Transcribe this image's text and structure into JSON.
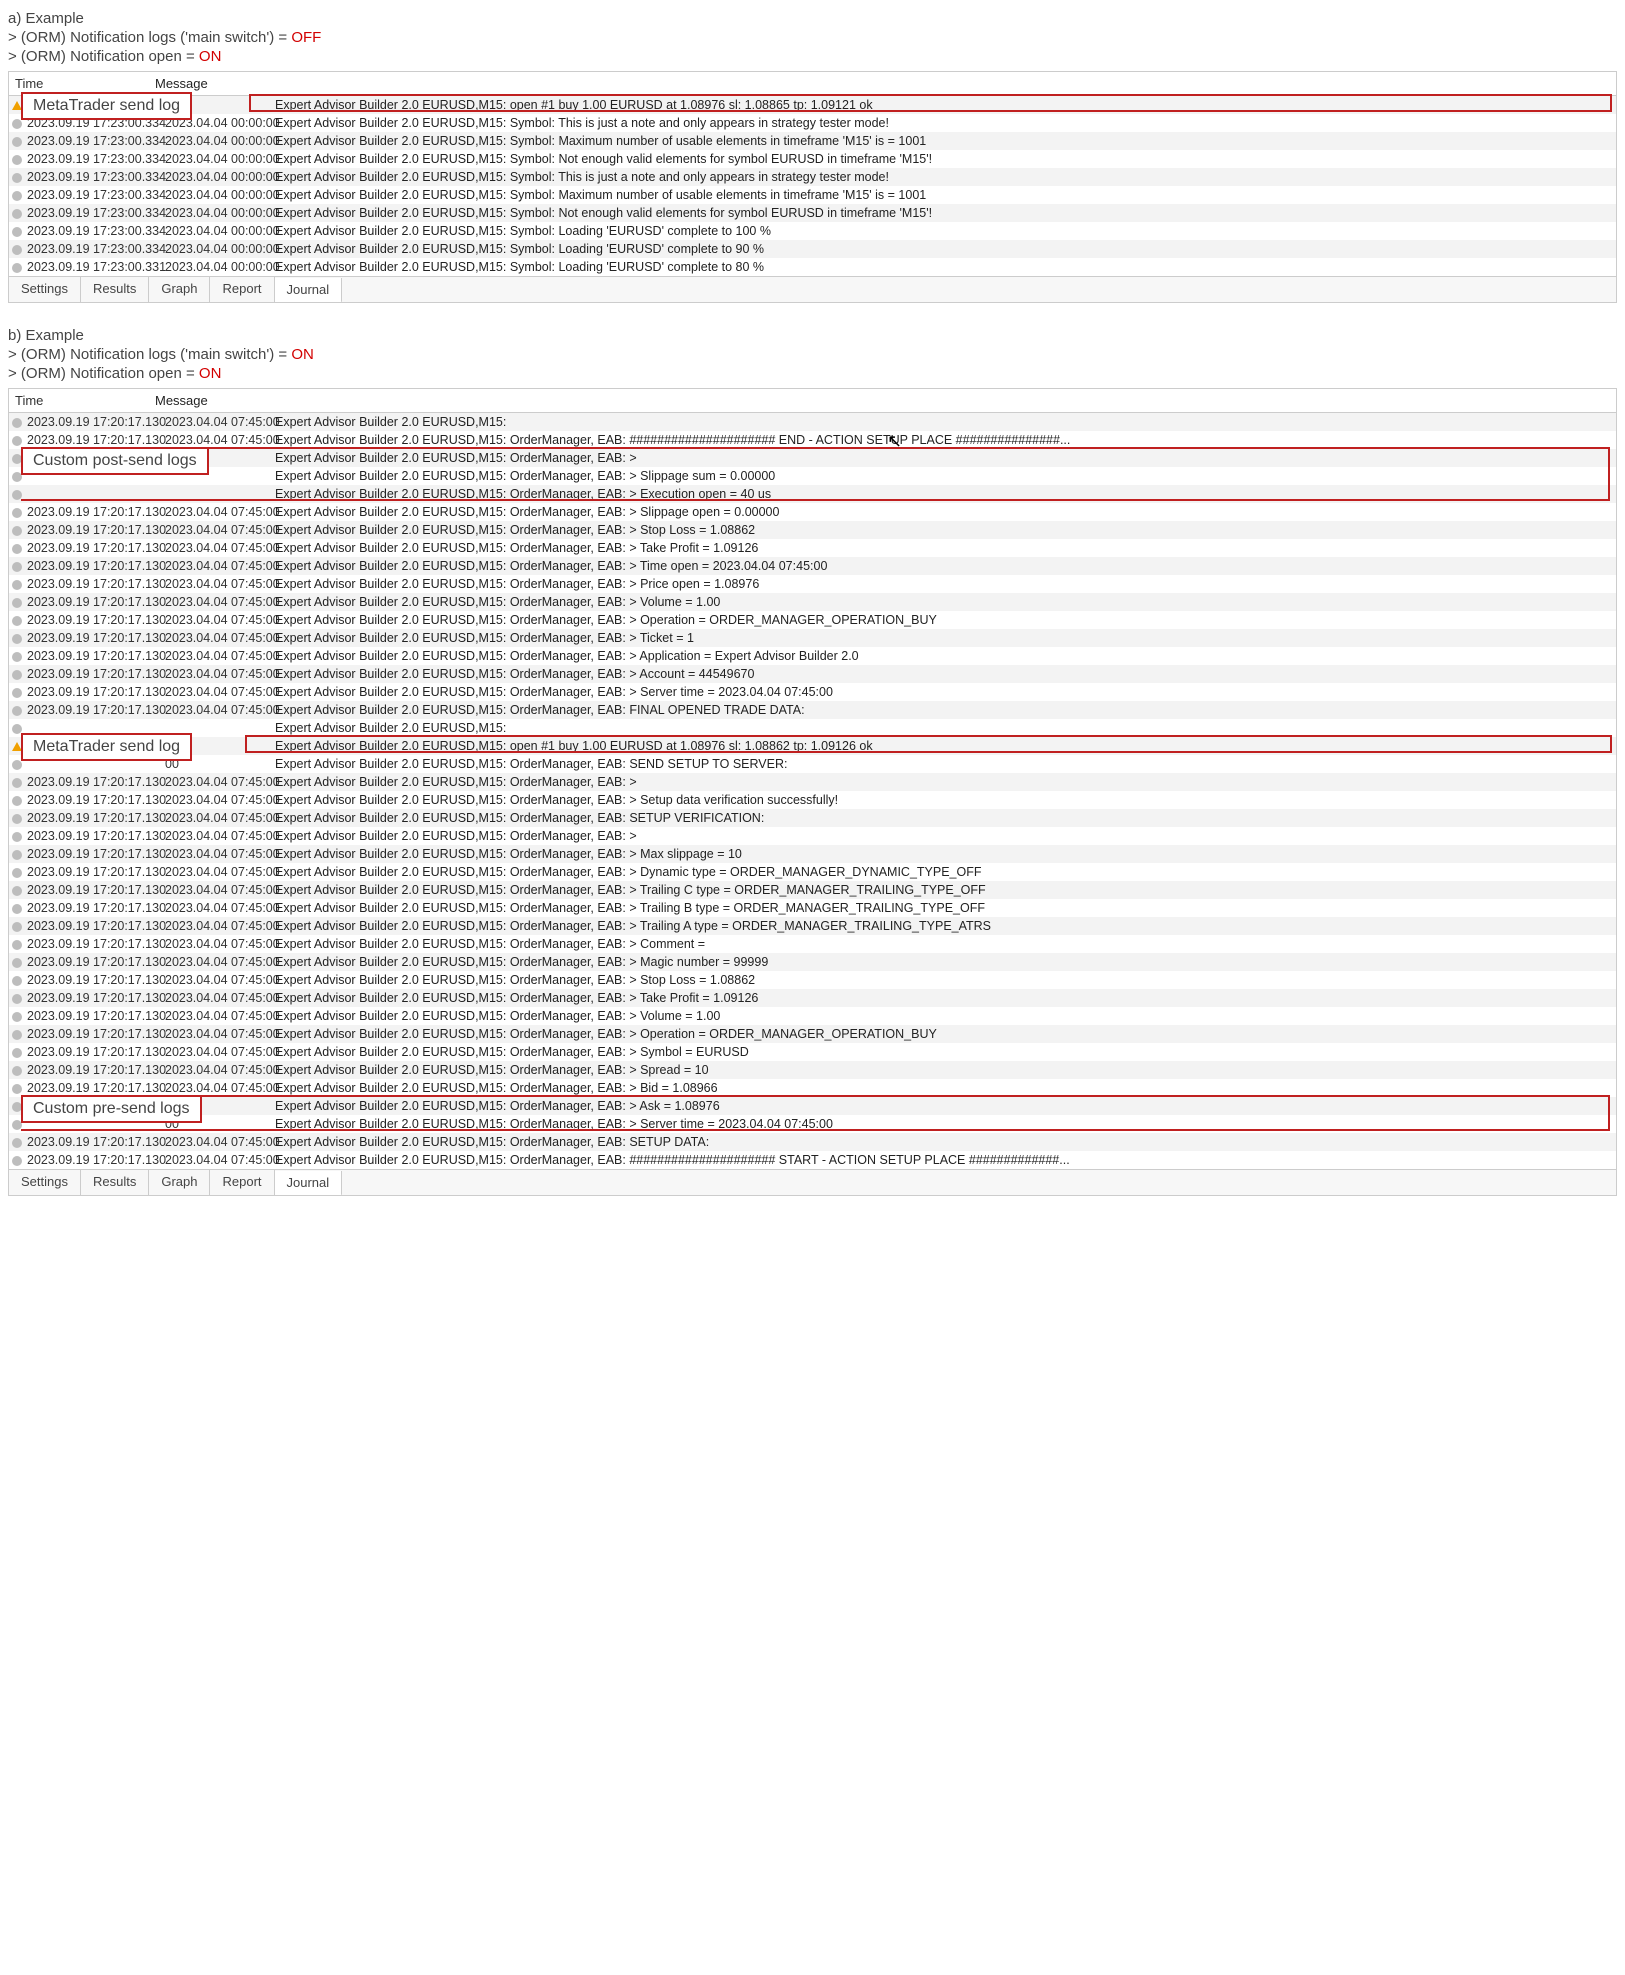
{
  "sections": {
    "a": {
      "title": "a) Example",
      "settings": [
        {
          "label": "> (ORM) Notification logs ('main switch') = ",
          "value": "OFF",
          "cls": "off"
        },
        {
          "label": "> (ORM) Notification open = ",
          "value": "ON",
          "cls": "on"
        }
      ],
      "callouts": {
        "mt_send": "MetaTrader send log"
      },
      "headers": {
        "time": "Time",
        "message": "Message"
      },
      "rows": [
        {
          "icon": "warn",
          "time": "",
          "ts2": "00",
          "msg": "Expert Advisor Builder 2.0 EURUSD,M15: open #1 buy 1.00 EURUSD at 1.08976 sl: 1.08865 tp: 1.09121 ok"
        },
        {
          "icon": "dot",
          "time": "2023.09.19 17:23:00.334",
          "ts2": "2023.04.04 00:00:00",
          "msg": "Expert Advisor Builder 2.0 EURUSD,M15: Symbol: This is just a note and only appears in strategy tester mode!"
        },
        {
          "icon": "dot",
          "time": "2023.09.19 17:23:00.334",
          "ts2": "2023.04.04 00:00:00",
          "msg": "Expert Advisor Builder 2.0 EURUSD,M15: Symbol: Maximum number of usable elements in timeframe 'M15' is = 1001"
        },
        {
          "icon": "dot",
          "time": "2023.09.19 17:23:00.334",
          "ts2": "2023.04.04 00:00:00",
          "msg": "Expert Advisor Builder 2.0 EURUSD,M15: Symbol: Not enough valid elements for symbol EURUSD in timeframe 'M15'!"
        },
        {
          "icon": "dot",
          "time": "2023.09.19 17:23:00.334",
          "ts2": "2023.04.04 00:00:00",
          "msg": "Expert Advisor Builder 2.0 EURUSD,M15: Symbol: This is just a note and only appears in strategy tester mode!"
        },
        {
          "icon": "dot",
          "time": "2023.09.19 17:23:00.334",
          "ts2": "2023.04.04 00:00:00",
          "msg": "Expert Advisor Builder 2.0 EURUSD,M15: Symbol: Maximum number of usable elements in timeframe 'M15' is = 1001"
        },
        {
          "icon": "dot",
          "time": "2023.09.19 17:23:00.334",
          "ts2": "2023.04.04 00:00:00",
          "msg": "Expert Advisor Builder 2.0 EURUSD,M15: Symbol: Not enough valid elements for symbol EURUSD in timeframe 'M15'!"
        },
        {
          "icon": "dot",
          "time": "2023.09.19 17:23:00.334",
          "ts2": "2023.04.04 00:00:00",
          "msg": "Expert Advisor Builder 2.0 EURUSD,M15: Symbol: Loading 'EURUSD' complete to 100 %"
        },
        {
          "icon": "dot",
          "time": "2023.09.19 17:23:00.334",
          "ts2": "2023.04.04 00:00:00",
          "msg": "Expert Advisor Builder 2.0 EURUSD,M15: Symbol: Loading 'EURUSD' complete to 90 %"
        },
        {
          "icon": "dot",
          "time": "2023.09.19 17:23:00.331",
          "ts2": "2023.04.04 00:00:00",
          "msg": "Expert Advisor Builder 2.0 EURUSD,M15: Symbol: Loading 'EURUSD' complete to 80 %"
        }
      ]
    },
    "b": {
      "title": "b) Example",
      "settings": [
        {
          "label": "> (ORM) Notification logs ('main switch') = ",
          "value": "ON",
          "cls": "on"
        },
        {
          "label": "> (ORM) Notification open = ",
          "value": "ON",
          "cls": "on"
        }
      ],
      "callouts": {
        "post": "Custom post-send logs",
        "mt_send": "MetaTrader send log",
        "pre": "Custom pre-send logs"
      },
      "headers": {
        "time": "Time",
        "message": "Message"
      },
      "rows": [
        {
          "icon": "dot",
          "time": "2023.09.19 17:20:17.130",
          "ts2": "2023.04.04 07:45:00",
          "msg": "Expert Advisor Builder 2.0 EURUSD,M15:"
        },
        {
          "icon": "dot",
          "time": "2023.09.19 17:20:17.130",
          "ts2": "2023.04.04 07:45:00",
          "msg": "Expert Advisor Builder 2.0 EURUSD,M15: OrderManager, EAB: ##################### END - ACTION SETUP PLACE ###############..."
        },
        {
          "icon": "dot",
          "time": "",
          "ts2": "",
          "msg": "Expert Advisor Builder 2.0 EURUSD,M15: OrderManager, EAB: >"
        },
        {
          "icon": "dot",
          "time": "",
          "ts2": "",
          "msg": "Expert Advisor Builder 2.0 EURUSD,M15: OrderManager, EAB: > Slippage sum = 0.00000"
        },
        {
          "icon": "dot",
          "time": "",
          "ts2": "",
          "msg": "Expert Advisor Builder 2.0 EURUSD,M15: OrderManager, EAB: > Execution open = 40 us"
        },
        {
          "icon": "dot",
          "time": "2023.09.19 17:20:17.130",
          "ts2": "2023.04.04 07:45:00",
          "msg": "Expert Advisor Builder 2.0 EURUSD,M15: OrderManager, EAB: > Slippage open = 0.00000"
        },
        {
          "icon": "dot",
          "time": "2023.09.19 17:20:17.130",
          "ts2": "2023.04.04 07:45:00",
          "msg": "Expert Advisor Builder 2.0 EURUSD,M15: OrderManager, EAB: > Stop Loss = 1.08862"
        },
        {
          "icon": "dot",
          "time": "2023.09.19 17:20:17.130",
          "ts2": "2023.04.04 07:45:00",
          "msg": "Expert Advisor Builder 2.0 EURUSD,M15: OrderManager, EAB: > Take Profit = 1.09126"
        },
        {
          "icon": "dot",
          "time": "2023.09.19 17:20:17.130",
          "ts2": "2023.04.04 07:45:00",
          "msg": "Expert Advisor Builder 2.0 EURUSD,M15: OrderManager, EAB: > Time open = 2023.04.04 07:45:00"
        },
        {
          "icon": "dot",
          "time": "2023.09.19 17:20:17.130",
          "ts2": "2023.04.04 07:45:00",
          "msg": "Expert Advisor Builder 2.0 EURUSD,M15: OrderManager, EAB: > Price open = 1.08976"
        },
        {
          "icon": "dot",
          "time": "2023.09.19 17:20:17.130",
          "ts2": "2023.04.04 07:45:00",
          "msg": "Expert Advisor Builder 2.0 EURUSD,M15: OrderManager, EAB: > Volume = 1.00"
        },
        {
          "icon": "dot",
          "time": "2023.09.19 17:20:17.130",
          "ts2": "2023.04.04 07:45:00",
          "msg": "Expert Advisor Builder 2.0 EURUSD,M15: OrderManager, EAB: > Operation = ORDER_MANAGER_OPERATION_BUY"
        },
        {
          "icon": "dot",
          "time": "2023.09.19 17:20:17.130",
          "ts2": "2023.04.04 07:45:00",
          "msg": "Expert Advisor Builder 2.0 EURUSD,M15: OrderManager, EAB: > Ticket = 1"
        },
        {
          "icon": "dot",
          "time": "2023.09.19 17:20:17.130",
          "ts2": "2023.04.04 07:45:00",
          "msg": "Expert Advisor Builder 2.0 EURUSD,M15: OrderManager, EAB: > Application = Expert Advisor Builder 2.0"
        },
        {
          "icon": "dot",
          "time": "2023.09.19 17:20:17.130",
          "ts2": "2023.04.04 07:45:00",
          "msg": "Expert Advisor Builder 2.0 EURUSD,M15: OrderManager, EAB: > Account = 44549670"
        },
        {
          "icon": "dot",
          "time": "2023.09.19 17:20:17.130",
          "ts2": "2023.04.04 07:45:00",
          "msg": "Expert Advisor Builder 2.0 EURUSD,M15: OrderManager, EAB: > Server time = 2023.04.04 07:45:00"
        },
        {
          "icon": "dot",
          "time": "2023.09.19 17:20:17.130",
          "ts2": "2023.04.04 07:45:00",
          "msg": "Expert Advisor Builder 2.0 EURUSD,M15: OrderManager, EAB: FINAL OPENED TRADE DATA:"
        },
        {
          "icon": "dot",
          "time": "",
          "ts2": "",
          "msg": "Expert Advisor Builder 2.0 EURUSD,M15:"
        },
        {
          "icon": "warn",
          "time": "",
          "ts2": "00",
          "msg": "Expert Advisor Builder 2.0 EURUSD,M15: open #1 buy 1.00 EURUSD at 1.08976 sl: 1.08862 tp: 1.09126 ok"
        },
        {
          "icon": "dot",
          "time": "",
          "ts2": "00",
          "msg": "Expert Advisor Builder 2.0 EURUSD,M15: OrderManager, EAB: SEND SETUP TO SERVER:"
        },
        {
          "icon": "dot",
          "time": "2023.09.19 17:20:17.130",
          "ts2": "2023.04.04 07:45:00",
          "msg": "Expert Advisor Builder 2.0 EURUSD,M15: OrderManager, EAB: >"
        },
        {
          "icon": "dot",
          "time": "2023.09.19 17:20:17.130",
          "ts2": "2023.04.04 07:45:00",
          "msg": "Expert Advisor Builder 2.0 EURUSD,M15: OrderManager, EAB: > Setup data verification successfully!"
        },
        {
          "icon": "dot",
          "time": "2023.09.19 17:20:17.130",
          "ts2": "2023.04.04 07:45:00",
          "msg": "Expert Advisor Builder 2.0 EURUSD,M15: OrderManager, EAB: SETUP VERIFICATION:"
        },
        {
          "icon": "dot",
          "time": "2023.09.19 17:20:17.130",
          "ts2": "2023.04.04 07:45:00",
          "msg": "Expert Advisor Builder 2.0 EURUSD,M15: OrderManager, EAB: >"
        },
        {
          "icon": "dot",
          "time": "2023.09.19 17:20:17.130",
          "ts2": "2023.04.04 07:45:00",
          "msg": "Expert Advisor Builder 2.0 EURUSD,M15: OrderManager, EAB: > Max slippage = 10"
        },
        {
          "icon": "dot",
          "time": "2023.09.19 17:20:17.130",
          "ts2": "2023.04.04 07:45:00",
          "msg": "Expert Advisor Builder 2.0 EURUSD,M15: OrderManager, EAB: > Dynamic type = ORDER_MANAGER_DYNAMIC_TYPE_OFF"
        },
        {
          "icon": "dot",
          "time": "2023.09.19 17:20:17.130",
          "ts2": "2023.04.04 07:45:00",
          "msg": "Expert Advisor Builder 2.0 EURUSD,M15: OrderManager, EAB: > Trailing C type = ORDER_MANAGER_TRAILING_TYPE_OFF"
        },
        {
          "icon": "dot",
          "time": "2023.09.19 17:20:17.130",
          "ts2": "2023.04.04 07:45:00",
          "msg": "Expert Advisor Builder 2.0 EURUSD,M15: OrderManager, EAB: > Trailing B type = ORDER_MANAGER_TRAILING_TYPE_OFF"
        },
        {
          "icon": "dot",
          "time": "2023.09.19 17:20:17.130",
          "ts2": "2023.04.04 07:45:00",
          "msg": "Expert Advisor Builder 2.0 EURUSD,M15: OrderManager, EAB: > Trailing A type = ORDER_MANAGER_TRAILING_TYPE_ATRS"
        },
        {
          "icon": "dot",
          "time": "2023.09.19 17:20:17.130",
          "ts2": "2023.04.04 07:45:00",
          "msg": "Expert Advisor Builder 2.0 EURUSD,M15: OrderManager, EAB: > Comment ="
        },
        {
          "icon": "dot",
          "time": "2023.09.19 17:20:17.130",
          "ts2": "2023.04.04 07:45:00",
          "msg": "Expert Advisor Builder 2.0 EURUSD,M15: OrderManager, EAB: > Magic number = 99999"
        },
        {
          "icon": "dot",
          "time": "2023.09.19 17:20:17.130",
          "ts2": "2023.04.04 07:45:00",
          "msg": "Expert Advisor Builder 2.0 EURUSD,M15: OrderManager, EAB: > Stop Loss = 1.08862"
        },
        {
          "icon": "dot",
          "time": "2023.09.19 17:20:17.130",
          "ts2": "2023.04.04 07:45:00",
          "msg": "Expert Advisor Builder 2.0 EURUSD,M15: OrderManager, EAB: > Take Profit = 1.09126"
        },
        {
          "icon": "dot",
          "time": "2023.09.19 17:20:17.130",
          "ts2": "2023.04.04 07:45:00",
          "msg": "Expert Advisor Builder 2.0 EURUSD,M15: OrderManager, EAB: > Volume = 1.00"
        },
        {
          "icon": "dot",
          "time": "2023.09.19 17:20:17.130",
          "ts2": "2023.04.04 07:45:00",
          "msg": "Expert Advisor Builder 2.0 EURUSD,M15: OrderManager, EAB: > Operation = ORDER_MANAGER_OPERATION_BUY"
        },
        {
          "icon": "dot",
          "time": "2023.09.19 17:20:17.130",
          "ts2": "2023.04.04 07:45:00",
          "msg": "Expert Advisor Builder 2.0 EURUSD,M15: OrderManager, EAB: > Symbol = EURUSD"
        },
        {
          "icon": "dot",
          "time": "2023.09.19 17:20:17.130",
          "ts2": "2023.04.04 07:45:00",
          "msg": "Expert Advisor Builder 2.0 EURUSD,M15: OrderManager, EAB: > Spread = 10"
        },
        {
          "icon": "dot",
          "time": "2023.09.19 17:20:17.130",
          "ts2": "2023.04.04 07:45:00",
          "msg": "Expert Advisor Builder 2.0 EURUSD,M15: OrderManager, EAB: > Bid = 1.08966"
        },
        {
          "icon": "dot",
          "time": "",
          "ts2": "00",
          "msg": "Expert Advisor Builder 2.0 EURUSD,M15: OrderManager, EAB: > Ask = 1.08976"
        },
        {
          "icon": "dot",
          "time": "",
          "ts2": "00",
          "msg": "Expert Advisor Builder 2.0 EURUSD,M15: OrderManager, EAB: > Server time = 2023.04.04 07:45:00"
        },
        {
          "icon": "dot",
          "time": "2023.09.19 17:20:17.130",
          "ts2": "2023.04.04 07:45:00",
          "msg": "Expert Advisor Builder 2.0 EURUSD,M15: OrderManager, EAB: SETUP DATA:"
        },
        {
          "icon": "dot",
          "time": "2023.09.19 17:20:17.130",
          "ts2": "2023.04.04 07:45:00",
          "msg": "Expert Advisor Builder 2.0 EURUSD,M15: OrderManager, EAB: ##################### START - ACTION SETUP PLACE #############..."
        }
      ]
    }
  },
  "tabs": [
    {
      "label": "Settings",
      "active": false
    },
    {
      "label": "Results",
      "active": false
    },
    {
      "label": "Graph",
      "active": false
    },
    {
      "label": "Report",
      "active": false
    },
    {
      "label": "Journal",
      "active": true
    }
  ]
}
